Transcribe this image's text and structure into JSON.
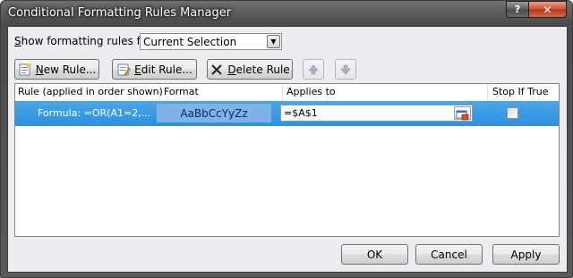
{
  "window": {
    "title": "Conditional Formatting Rules Manager"
  },
  "titlebar": {
    "help_label": "?",
    "close_label": "✕"
  },
  "show_rules": {
    "label_prefix": "S",
    "label_rest": "how formatting rules for:",
    "selected": "Current Selection"
  },
  "toolbar": {
    "new_rule": {
      "accel": "N",
      "rest": "ew Rule..."
    },
    "edit_rule": {
      "accel": "E",
      "rest": "dit Rule..."
    },
    "delete_rule": {
      "accel": "D",
      "rest": "elete Rule"
    }
  },
  "grid": {
    "headers": [
      "Rule (applied in order shown)",
      "Format",
      "Applies to",
      "Stop If True"
    ],
    "rows": [
      {
        "rule": "Formula: =OR(A1=2,...",
        "format_preview": "AaBbCcYyZz",
        "applies_to": "=$A$1",
        "stop_if_true": false
      }
    ]
  },
  "footer": {
    "ok": "OK",
    "cancel": "Cancel",
    "apply": "Apply"
  },
  "colors": {
    "selection": "#3399ff",
    "format_preview_bg": "#7fb2e8",
    "close": "#c8502f"
  },
  "icons": [
    "help-icon",
    "close-icon",
    "new-rule-icon",
    "edit-rule-icon",
    "delete-x-icon",
    "move-up-icon",
    "move-down-icon",
    "dropdown-arrow-icon",
    "collapse-dialog-icon",
    "checkbox-icon"
  ]
}
